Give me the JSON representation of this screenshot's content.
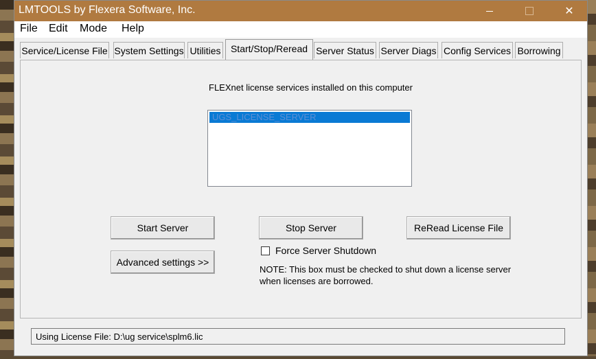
{
  "window": {
    "title": "LMTOOLS by Flexera Software, Inc.",
    "controls": {
      "minimize_icon": "minimize-icon",
      "maximize_icon": "maximize-icon",
      "close_icon": "close-icon",
      "close_glyph": "✕"
    }
  },
  "menu": {
    "items": [
      "File",
      "Edit",
      "Mode",
      "Help"
    ]
  },
  "tabs": [
    "Service/License File",
    "System Settings",
    "Utilities",
    "Start/Stop/Reread",
    "Server Status",
    "Server Diags",
    "Config Services",
    "Borrowing"
  ],
  "active_tab": "Start/Stop/Reread",
  "panel": {
    "heading": "FLEXnet license services installed on this computer",
    "services": [
      "UGS_LICENSE_SERVER"
    ],
    "selected_service": "UGS_LICENSE_SERVER",
    "buttons": {
      "start": "Start Server",
      "stop": "Stop Server",
      "reread": "ReRead License File",
      "advanced": "Advanced settings >>"
    },
    "force_shutdown": {
      "label": "Force Server Shutdown",
      "checked": false
    },
    "note_line1": "NOTE:  This box must be checked to shut down a license server",
    "note_line2": "when licenses are borrowed."
  },
  "status": {
    "text": "Using License File:  D:\\ug service\\splm6.lic"
  },
  "colors": {
    "titlebar": "#b07a40",
    "selection": "#0a7ad4"
  }
}
